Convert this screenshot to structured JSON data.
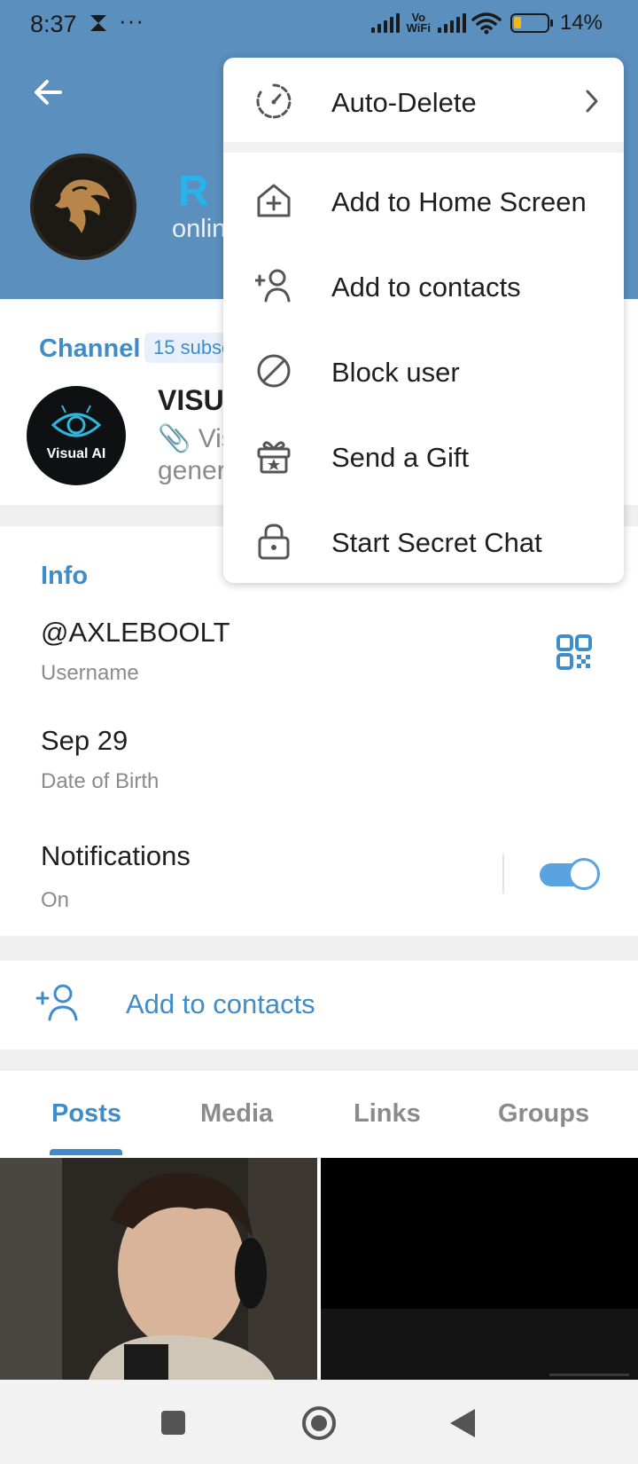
{
  "status_bar": {
    "time": "8:37",
    "dots": "···",
    "vowifi_line1": "Vo",
    "vowifi_line2": "WiFi",
    "battery_percent": "14%",
    "battery_level": 0.14
  },
  "profile": {
    "name_partial": "R",
    "status_partial": "onlin"
  },
  "channel": {
    "section_title": "Channel",
    "subscribers_badge": "15 subsc",
    "name_partial": "VISU",
    "desc_line1": "📎 Vis",
    "desc_line2": "gener",
    "avatar_label": "Visual AI"
  },
  "info": {
    "title": "Info",
    "username_value": "@AXLEBOOLT",
    "username_label": "Username",
    "dob_value": "Sep 29",
    "dob_label": "Date of Birth",
    "notifications_value": "Notifications",
    "notifications_label": "On",
    "notifications_on": true
  },
  "add_contacts": {
    "label": "Add to contacts"
  },
  "tabs": [
    {
      "label": "Posts",
      "active": true
    },
    {
      "label": "Media",
      "active": false
    },
    {
      "label": "Links",
      "active": false
    },
    {
      "label": "Groups",
      "active": false
    }
  ],
  "menu": {
    "items": [
      {
        "label": "Auto-Delete",
        "icon": "timer-icon"
      },
      {
        "label": "Add to Home Screen",
        "icon": "add-home-icon"
      },
      {
        "label": "Add to contacts",
        "icon": "add-user-icon"
      },
      {
        "label": "Block user",
        "icon": "block-icon"
      },
      {
        "label": "Send a Gift",
        "icon": "gift-icon"
      },
      {
        "label": "Start Secret Chat",
        "icon": "lock-icon"
      }
    ]
  },
  "colors": {
    "header": "#5b8fbe",
    "accent": "#3f8ccb",
    "name": "#2ab3ea"
  }
}
